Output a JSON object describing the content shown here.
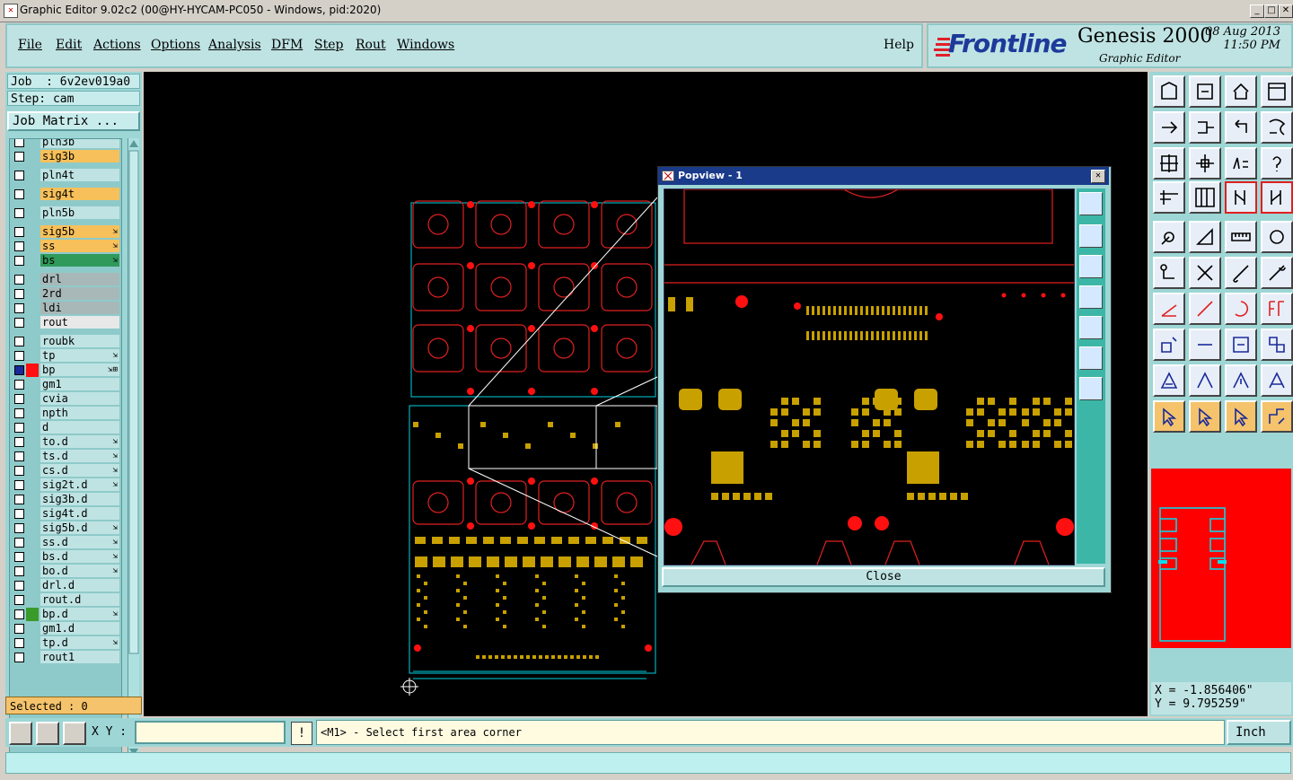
{
  "window": {
    "title": "Graphic Editor 9.02c2 (00@HY-HYCAM-PC050 - Windows, pid:2020)",
    "min": "_",
    "max": "□",
    "close": "✕"
  },
  "menu": [
    "File",
    "Edit",
    "Actions",
    "Options",
    "Analysis",
    "DFM",
    "Step",
    "Rout",
    "Windows"
  ],
  "help": "Help",
  "brand": {
    "logo": "Frontline",
    "product": "Genesis 2000",
    "subtitle": "Graphic Editor",
    "date": "08 Aug 2013",
    "time": "11:50 PM"
  },
  "job": {
    "job_line": "Job  : 6v2ev019a0",
    "step_line": "Step: cam",
    "matrix_button": "Job Matrix ..."
  },
  "layers": [
    {
      "name": "pln3b",
      "color": "#bfe3e3",
      "gap": false
    },
    {
      "name": "sig3b",
      "color": "#f7c05a",
      "gap": false
    },
    {
      "name": "pln4t",
      "color": "#bfe3e3",
      "gap": true
    },
    {
      "name": "sig4t",
      "color": "#f7c05a",
      "gap": true
    },
    {
      "name": "pln5b",
      "color": "#bfe3e3",
      "gap": true
    },
    {
      "name": "sig5b",
      "color": "#f7c05a",
      "gap": true,
      "flag": "⇲"
    },
    {
      "name": "ss",
      "color": "#f7c05a",
      "gap": false,
      "flag": "⇲"
    },
    {
      "name": "bs",
      "color": "#2f9a5a",
      "gap": false,
      "flag": "⇲"
    },
    {
      "name": "drl",
      "color": "#a8b8b8",
      "gap": true
    },
    {
      "name": "2rd",
      "color": "#a8b8b8",
      "gap": false
    },
    {
      "name": "ldi",
      "color": "#a8b8b8",
      "gap": false
    },
    {
      "name": "rout",
      "color": "#e8e8e8",
      "gap": false
    },
    {
      "name": "roubk",
      "color": "#bfe3e3",
      "gap": true
    },
    {
      "name": "tp",
      "color": "#bfe3e3",
      "gap": false,
      "flag": "⇲"
    },
    {
      "name": "bp",
      "color": "#bfe3e3",
      "gap": false,
      "flag": "⇲⊞",
      "selected": true
    },
    {
      "name": "gm1",
      "color": "#bfe3e3",
      "gap": false
    },
    {
      "name": "cvia",
      "color": "#bfe3e3",
      "gap": false
    },
    {
      "name": "npth",
      "color": "#bfe3e3",
      "gap": false
    },
    {
      "name": "d",
      "color": "#bfe3e3",
      "gap": false
    },
    {
      "name": "to.d",
      "color": "#bfe3e3",
      "gap": false,
      "flag": "⇲"
    },
    {
      "name": "ts.d",
      "color": "#bfe3e3",
      "gap": false,
      "flag": "⇲"
    },
    {
      "name": "cs.d",
      "color": "#bfe3e3",
      "gap": false,
      "flag": "⇲"
    },
    {
      "name": "sig2t.d",
      "color": "#bfe3e3",
      "gap": false,
      "flag": "⇲"
    },
    {
      "name": "sig3b.d",
      "color": "#bfe3e3",
      "gap": false
    },
    {
      "name": "sig4t.d",
      "color": "#bfe3e3",
      "gap": false
    },
    {
      "name": "sig5b.d",
      "color": "#bfe3e3",
      "gap": false,
      "flag": "⇲"
    },
    {
      "name": "ss.d",
      "color": "#bfe3e3",
      "gap": false,
      "flag": "⇲"
    },
    {
      "name": "bs.d",
      "color": "#bfe3e3",
      "gap": false,
      "flag": "⇲"
    },
    {
      "name": "bo.d",
      "color": "#bfe3e3",
      "gap": false,
      "flag": "⇲"
    },
    {
      "name": "drl.d",
      "color": "#bfe3e3",
      "gap": false
    },
    {
      "name": "rout.d",
      "color": "#bfe3e3",
      "gap": false
    },
    {
      "name": "bp.d",
      "color": "#bfe3e3",
      "gap": false,
      "flag": "⇲",
      "marker": "#3a9a2a"
    },
    {
      "name": "gm1.d",
      "color": "#bfe3e3",
      "gap": false
    },
    {
      "name": "tp.d",
      "color": "#bfe3e3",
      "gap": false,
      "flag": "⇲"
    },
    {
      "name": "rout1",
      "color": "#bfe3e3",
      "gap": false
    }
  ],
  "selected": "Selected : 0",
  "popview": {
    "title": "Popview - 1",
    "close_button": "Close"
  },
  "coords": {
    "x": "X = -1.856406\"",
    "y": "Y = 9.795259\""
  },
  "bottom": {
    "xy_label": "X Y :",
    "xy_value": "",
    "prompt_button": "!",
    "prompt": "<M1> - Select first area corner",
    "unit": "Inch"
  },
  "colors": {
    "outline": "#00d0e0",
    "copper": "#c8a000",
    "red": "#ff1010",
    "teal": "#9ed6d6"
  }
}
